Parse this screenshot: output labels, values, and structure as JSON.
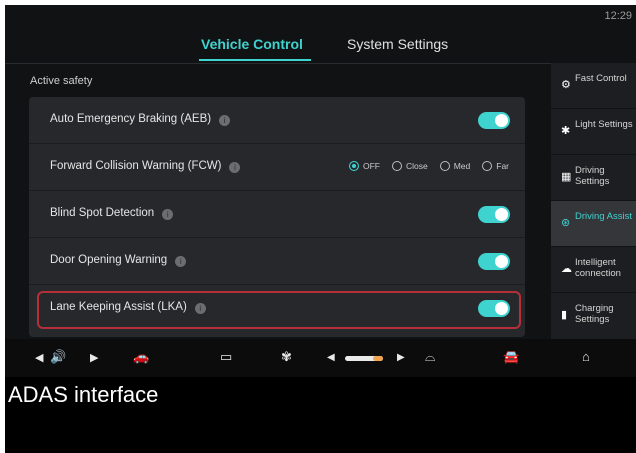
{
  "status": {
    "time": "12:29"
  },
  "tabs": [
    {
      "label": "Vehicle Control",
      "active": true
    },
    {
      "label": "System Settings",
      "active": false
    }
  ],
  "section": {
    "title": "Active safety"
  },
  "rows": [
    {
      "label": "Auto Emergency Braking (AEB)",
      "control": "toggle",
      "on": true
    },
    {
      "label": "Forward Collision Warning (FCW)",
      "control": "radio",
      "options": [
        "OFF",
        "Close",
        "Med",
        "Far"
      ],
      "selected": "OFF"
    },
    {
      "label": "Blind Spot Detection",
      "control": "toggle",
      "on": true
    },
    {
      "label": "Door Opening Warning",
      "control": "toggle",
      "on": true
    },
    {
      "label": "Lane Keeping Assist (LKA)",
      "control": "toggle",
      "on": true,
      "highlighted": true
    }
  ],
  "sidebar": [
    {
      "label": "Fast Control",
      "icon": "fast-control-icon",
      "active": false
    },
    {
      "label": "Light Settings",
      "icon": "light-icon",
      "active": false
    },
    {
      "label": "Driving Settings",
      "icon": "driving-settings-icon",
      "active": false
    },
    {
      "label": "Driving Assist",
      "icon": "steering-wheel-icon",
      "active": true
    },
    {
      "label": "Intelligent connection",
      "icon": "cloud-icon",
      "active": false
    },
    {
      "label": "Charging Settings",
      "icon": "battery-icon",
      "active": false
    }
  ],
  "bottom_bar": {
    "icons": [
      "volume-icon",
      "car-outline-icon",
      "rear-defrost-icon",
      "fan-power-icon",
      "temperature-slider",
      "front-defrost-icon",
      "car-front-icon",
      "home-icon"
    ],
    "temperature_level": 0.75
  },
  "caption": "ADAS interface",
  "colors": {
    "accent": "#3fd3d0",
    "highlight_border": "#b3303a",
    "panel": "#27282c",
    "background": "#111214"
  }
}
